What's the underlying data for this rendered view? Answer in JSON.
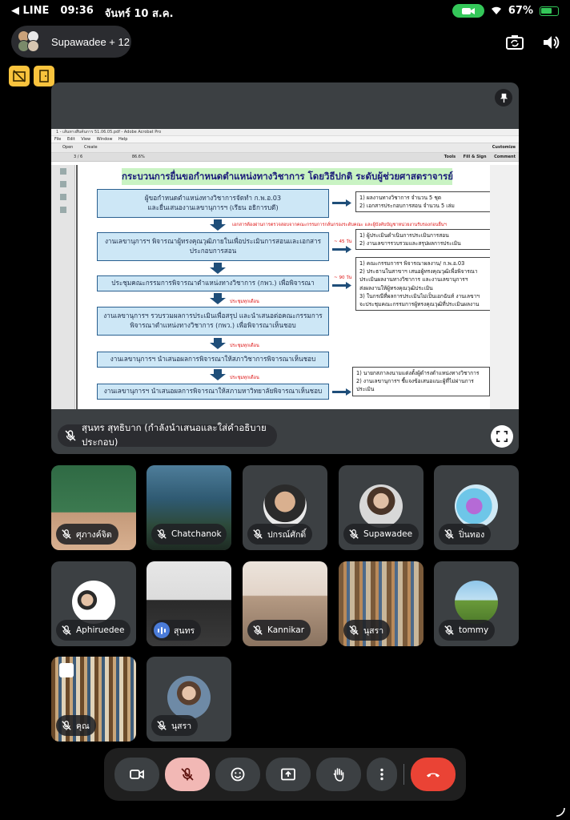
{
  "status_bar": {
    "back_app": "◀ LINE",
    "time": "09:36",
    "date": "จันทร์ 10 ส.ค.",
    "battery": "67%",
    "colors": {
      "camera_pill": "#34c759",
      "battery": "#34c759"
    }
  },
  "call": {
    "title": "Supawadee + 12",
    "icons": [
      "switch-camera-icon",
      "speaker-icon",
      "hide-video-icon",
      "door-exit-icon"
    ]
  },
  "presentation": {
    "presenter_label": "สุนทร สุทธิบาก (กำลังนำเสนอและใส่คำอธิบายประกอบ)",
    "acrobat": {
      "window_title": "1 - เส้นทางสืบค้นการ 51.06.05.pdf - Adobe Acrobat Pro",
      "menu": [
        "File",
        "Edit",
        "View",
        "Window",
        "Help"
      ],
      "toolbar": {
        "open": "Open",
        "create": "Create",
        "customize": "Customize"
      },
      "page_indicator": "3 / 6",
      "zoom": "86.6%",
      "right_tabs": [
        "Tools",
        "Fill & Sign",
        "Comment"
      ]
    },
    "document": {
      "title": "กระบวนการยื่นขอกำหนดตำแหน่งทางวิชาการ โดยวิธีปกติ ระดับผู้ช่วยศาสตราจารย์",
      "steps": [
        {
          "line1": "ผู้ขอกำหนดตำแหน่งทางวิชาการจัดทำ ก.พ.อ.03",
          "line2": "และยื่นเสนองานเลขานุการฯ (เรียน อธิการบดี)"
        },
        {
          "line1": "งานเลขานุการฯ พิจารณาผู้ทรงคุณวุฒิภายในเพื่อประเมินการสอนและเอกสาร",
          "line2": "ประกอบการสอน"
        },
        {
          "line1": "ประชุมคณะกรรมการพิจารณาตำแหน่งทางวิชาการ (กพว.) เพื่อพิจารณา",
          "line2": ""
        },
        {
          "line1": "งานเลขานุการฯ รวบรวมผลการประเมินเพื่อสรุป และนำเสนอต่อคณะกรรมการ",
          "line2": "พิจารณาตำแหน่งทางวิชาการ (กพว.) เพื่อพิจารณาเห็นชอบ"
        },
        {
          "line1": "งานเลขานุการฯ นำเสนอผลการพิจารณาให้สภาวิชาการพิจารณาเห็นชอบ",
          "line2": ""
        },
        {
          "line1": "งานเลขานุการฯ นำเสนอผลการพิจารณาให้สภามหาวิทยาลัยพิจารณาเห็นชอบ",
          "line2": ""
        }
      ],
      "notes": [
        [
          "1) ผลงานทางวิชาการ จำนวน 5 ชุด",
          "2) เอกสารประกอบการสอน จำนวน 5 เล่ม"
        ],
        [
          "1) ผู้ประเมินดำเนินการประเมินการสอน",
          "2) งานเลขาฯรวบรวมและสรุปผลการประเมิน"
        ],
        [
          "1) คณะกรรมการฯ พิจารณาผลงาน/ ก.พ.อ.03",
          "2) ประธานในสาขาฯ เสนอผู้ทรงคุณวุฒิเพื่อพิจารณา",
          "ประเมินผลงานทางวิชาการ และงานเลขานุการฯ",
          "ส่งผลงานให้ผู้ทรงคุณวุฒิประเมิน",
          "3) ในกรณีที่ผลการประเมินไม่เป็นเอกฉันท์ งานเลขาฯ",
          "จะประชุมคณะกรรมการผู้ทรงคุณวุฒิที่ประเมินผลงาน"
        ],
        [
          "1) นายกสภาลงนามแต่งตั้งผู้ดำรงตำแหน่งทางวิชาการ",
          "2) งานเลขานุการฯ ชี้แจงข้อเสนอแนะผู้ที่ไม่ผ่านการ",
          "ประเมิน"
        ]
      ],
      "red_labels": {
        "eval_note": "เอกสารต้องผ่านการตรวจสอบจากคณะกรรมการกลั่นกรองระดับคณะ และผู้บังคับบัญชาหน่วยงานรับรองก่อนยื่นฯ",
        "days_45": "~ 45 วัน",
        "days_90": "~ 90 วัน",
        "meeting_1": "ประชุมทุกเดือน",
        "meeting_2": "ประชุมทุกเดือน",
        "meeting_3": "ประชุมทุกเดือน"
      },
      "colors": {
        "title_bg": "#c9f3c3",
        "box_bg": "#cde7f6",
        "arrow": "#1f4e79",
        "red_text": "#dd1111"
      }
    }
  },
  "participants": [
    {
      "name": "ศุภางค์จิต",
      "mic": "off"
    },
    {
      "name": "Chatchanok",
      "mic": "off"
    },
    {
      "name": "ปกรณ์ศักดิ์",
      "mic": "off"
    },
    {
      "name": "Supawadee",
      "mic": "off"
    },
    {
      "name": "ปิ่นทอง",
      "mic": "off"
    },
    {
      "name": "Aphiruedee",
      "mic": "off"
    },
    {
      "name": "สุนทร",
      "mic": "speaking"
    },
    {
      "name": "Kannikar",
      "mic": "off"
    },
    {
      "name": "นุสรา",
      "mic": "off"
    },
    {
      "name": "tommy",
      "mic": "off"
    },
    {
      "name": "คุณ",
      "mic": "off"
    },
    {
      "name": "นุสรา",
      "mic": "off"
    }
  ],
  "controls": {
    "buttons": [
      "camera-icon",
      "mic-off-icon",
      "emoji-icon",
      "present-icon",
      "raise-hand-icon",
      "more-icon",
      "end-call-icon"
    ],
    "colors": {
      "mic_off_bg": "#f2b8b5",
      "end_call_bg": "#ea4335",
      "speaking": "#4a7bd8"
    }
  }
}
